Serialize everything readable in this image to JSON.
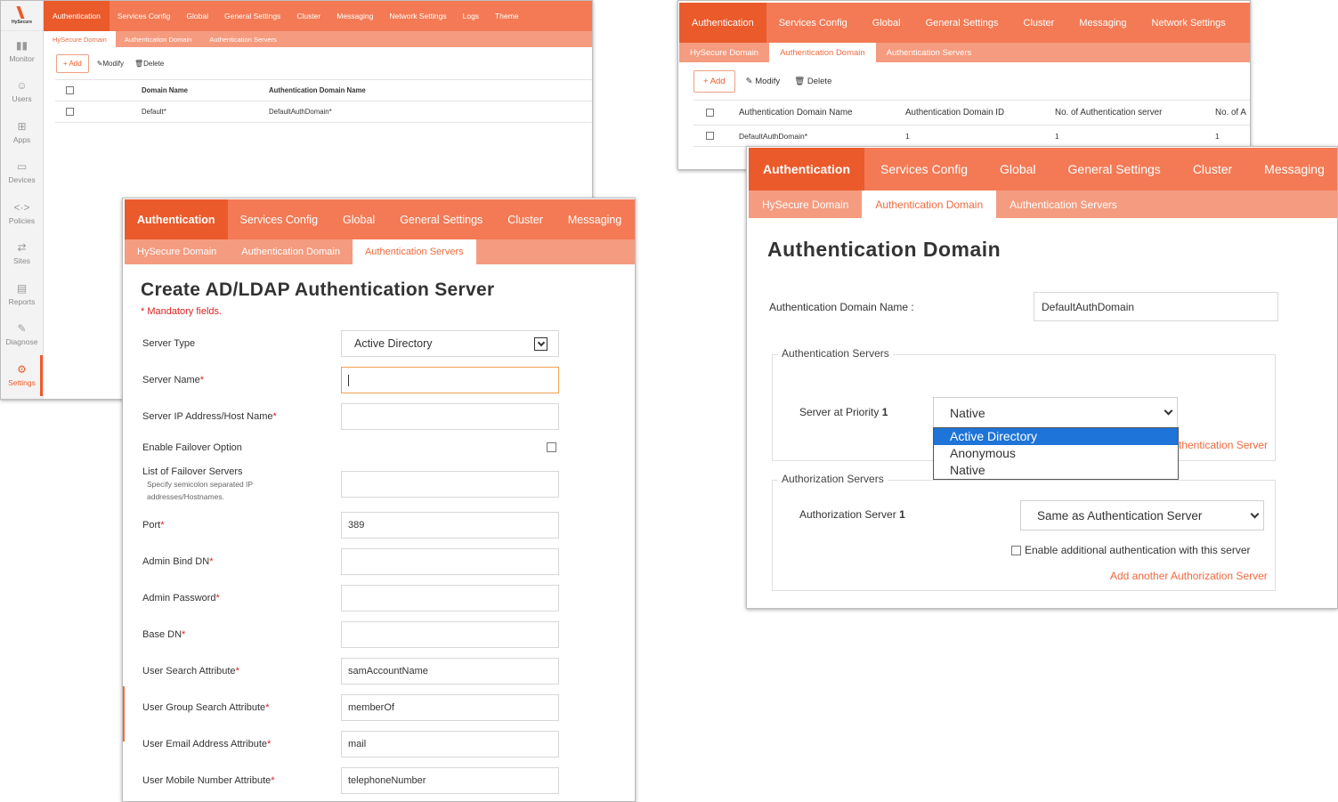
{
  "colors": {
    "accent": "#eb5a2b",
    "nav_bg": "#f37a55",
    "subnav_bg": "#f59b7f",
    "link": "#ef6a3f",
    "required": "#e02020",
    "dropdown_highlight": "#1e74d8"
  },
  "panel1": {
    "logo_text": "HySecure",
    "sidebar": [
      {
        "label": "Monitor",
        "icon": "bar-chart-icon"
      },
      {
        "label": "Users",
        "icon": "user-icon"
      },
      {
        "label": "Apps",
        "icon": "apps-icon"
      },
      {
        "label": "Devices",
        "icon": "laptop-icon"
      },
      {
        "label": "Policies",
        "icon": "code-arrows-icon"
      },
      {
        "label": "Sites",
        "icon": "swap-arrows-icon"
      },
      {
        "label": "Reports",
        "icon": "report-icon"
      },
      {
        "label": "Diagnose",
        "icon": "wrench-icon"
      },
      {
        "label": "Settings",
        "icon": "gear-icon"
      }
    ],
    "tabs": [
      "Authentication",
      "Services Config",
      "Global",
      "General Settings",
      "Cluster",
      "Messaging",
      "Network Settings",
      "Logs",
      "Theme"
    ],
    "subtabs": [
      "HySecure Domain",
      "Authentication Domain",
      "Authentication Servers"
    ],
    "toolbar": {
      "add": "Add",
      "modify": "Modify",
      "delete": "Delete"
    },
    "table": {
      "headers": [
        "Domain Name",
        "Authentication Domain Name"
      ],
      "rows": [
        [
          "Default*",
          "DefaultAuthDomain*"
        ]
      ]
    }
  },
  "panel2": {
    "tabs": [
      "Authentication",
      "Services Config",
      "Global",
      "General Settings",
      "Cluster",
      "Messaging",
      "Network Settings"
    ],
    "subtabs": [
      "HySecure Domain",
      "Authentication Domain",
      "Authentication Servers"
    ],
    "toolbar": {
      "add": "Add",
      "modify": "Modify",
      "delete": "Delete"
    },
    "table": {
      "headers": [
        "Authentication Domain Name",
        "Authentication Domain ID",
        "No. of Authentication server",
        "No. of A"
      ],
      "rows": [
        [
          "DefaultAuthDomain*",
          "1",
          "1",
          "1"
        ]
      ]
    }
  },
  "panel3": {
    "tabs": [
      "Authentication",
      "Services Config",
      "Global",
      "General Settings",
      "Cluster",
      "Messaging"
    ],
    "subtabs": [
      "HySecure Domain",
      "Authentication Domain",
      "Authentication Servers"
    ],
    "title": "Authentication Domain",
    "domain_name_label": "Authentication Domain Name :",
    "domain_name_value": "DefaultAuthDomain",
    "auth_servers_legend": "Authentication Servers",
    "priority_label": "Server at Priority",
    "priority_num": "1",
    "priority_select": "Native",
    "dropdown_options": [
      "Active Directory",
      "Anonymous",
      "Native"
    ],
    "add_auth_link_partial": "thentication Server",
    "authz_legend": "Authorization Servers",
    "authz_label": "Authorization Server",
    "authz_num": "1",
    "authz_select": "Same as Authentication Server",
    "enable_additional": "Enable additional authentication with this server",
    "add_authz_link": "Add another Authorization Server"
  },
  "panel4": {
    "tabs": [
      "Authentication",
      "Services Config",
      "Global",
      "General Settings",
      "Cluster",
      "Messaging"
    ],
    "subtabs": [
      "HySecure Domain",
      "Authentication Domain",
      "Authentication Servers"
    ],
    "title": "Create AD/LDAP Authentication Server",
    "mandatory": "* Mandatory fields.",
    "server_type_label": "Server Type",
    "server_type_value": "Active Directory",
    "fields": {
      "server_name": "Server Name",
      "server_ip": "Server IP Address/Host Name",
      "failover": "Enable Failover Option",
      "failover_list": "List of Failover Servers",
      "failover_hint": "Specify semicolon separated IP addresses/Hostnames.",
      "port": "Port",
      "port_value": "389",
      "admin_bind": "Admin Bind DN",
      "admin_pw": "Admin Password",
      "base_dn": "Base DN",
      "user_search": "User Search Attribute",
      "user_search_value": "samAccountName",
      "group_search": "User Group Search Attribute",
      "group_search_value": "memberOf",
      "email_attr": "User Email Address Attribute",
      "email_attr_value": "mail",
      "mobile_attr": "User Mobile Number Attribute",
      "mobile_attr_value": "telephoneNumber"
    },
    "req_mark": "*"
  }
}
